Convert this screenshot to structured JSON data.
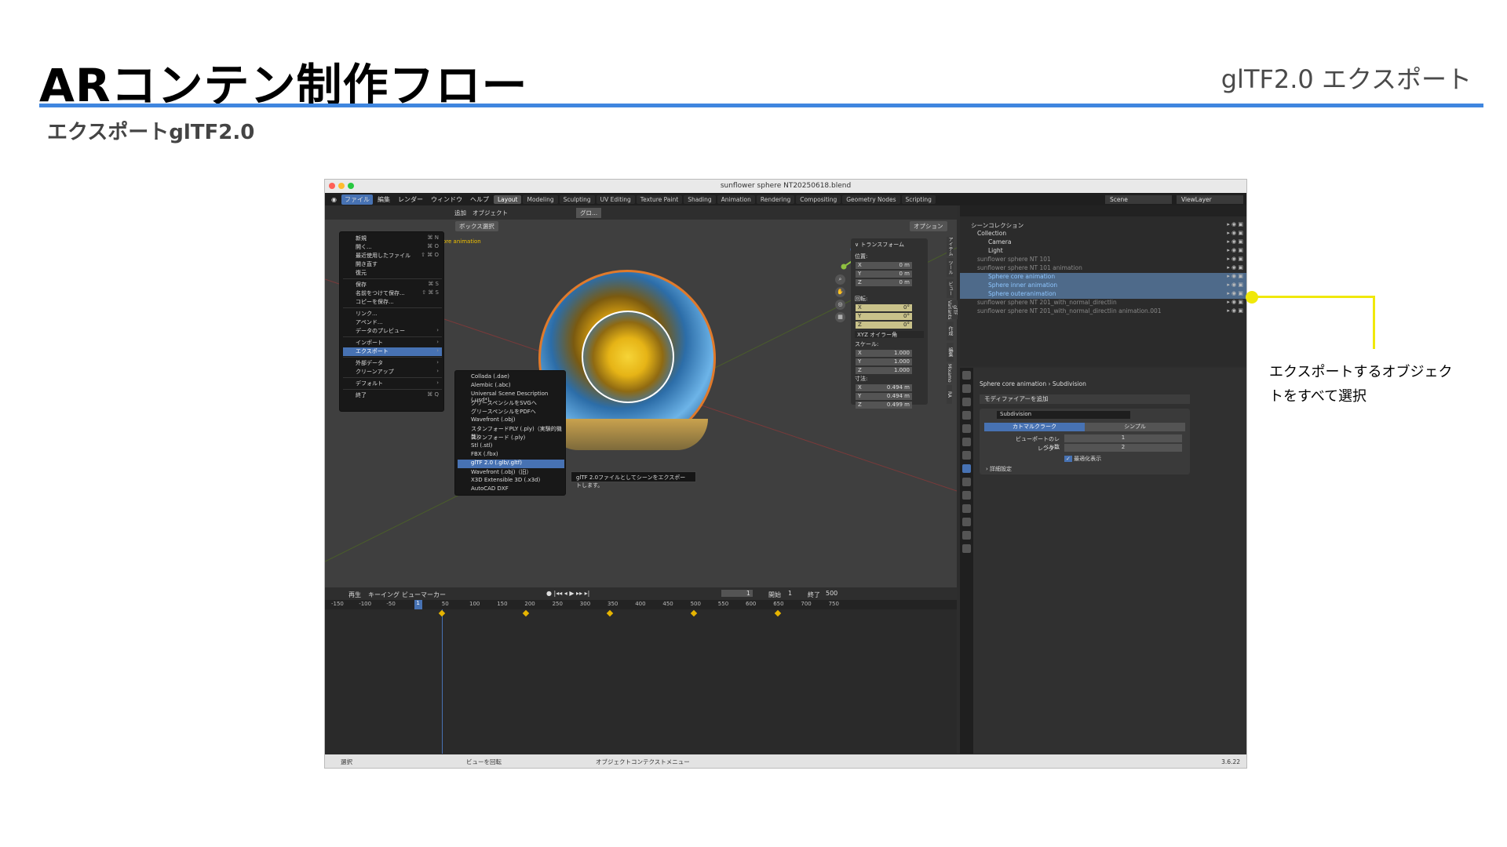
{
  "slide": {
    "title": "ARコンテン制作フロー",
    "topic": "glTF2.0 エクスポート",
    "subtitle": "エクスポートglTF2.0",
    "callout": "エクスポートするオブジェクトをすべて選択"
  },
  "blender": {
    "window_title": "sunflower sphere NT20250618.blend",
    "menus": [
      "ファイル",
      "編集",
      "レンダー",
      "ウィンドウ",
      "ヘルプ"
    ],
    "workspaces": [
      "Layout",
      "Modeling",
      "Sculpting",
      "UV Editing",
      "Texture Paint",
      "Shading",
      "Animation",
      "Rendering",
      "Compositing",
      "Geometry Nodes",
      "Scripting"
    ],
    "scene": "Scene",
    "view_layer": "ViewLayer",
    "vp_buttons": {
      "add": "追加",
      "object": "オブジェクト",
      "global": "グロ...",
      "box_select": "ボックス選択",
      "options": "オプション"
    },
    "viewport_label": "ore animation",
    "file_menu": [
      {
        "label": "新規",
        "shortcut": "⌘ N"
      },
      {
        "label": "開く...",
        "shortcut": "⌘ O"
      },
      {
        "label": "最近使用したファイル",
        "shortcut": "⇧ ⌘ O"
      },
      {
        "label": "開き直す",
        "shortcut": ""
      },
      {
        "label": "復元",
        "shortcut": ""
      },
      {
        "label": "保存",
        "shortcut": "⌘ S"
      },
      {
        "label": "名前をつけて保存...",
        "shortcut": "⇧ ⌘ S"
      },
      {
        "label": "コピーを保存...",
        "shortcut": ""
      },
      {
        "label": "リンク...",
        "shortcut": ""
      },
      {
        "label": "アペンド...",
        "shortcut": ""
      },
      {
        "label": "データのプレビュー",
        "shortcut": ""
      },
      {
        "label": "インポート",
        "shortcut": ""
      },
      {
        "label": "エクスポート",
        "shortcut": ""
      },
      {
        "label": "外部データ",
        "shortcut": ""
      },
      {
        "label": "クリーンアップ",
        "shortcut": ""
      },
      {
        "label": "デフォルト",
        "shortcut": ""
      },
      {
        "label": "終了",
        "shortcut": "⌘ Q"
      }
    ],
    "export_menu": [
      "Collada (.dae)",
      "Alembic (.abc)",
      "Universal Scene Description (.usd*)",
      "グリースペンシルをSVGへ",
      "グリースペンシルをPDFへ",
      "Wavefront (.obj)",
      "スタンフォードPLY (.ply)（実験的機能）",
      "スタンフォード (.ply)",
      "Stl (.stl)",
      "FBX (.fbx)",
      "glTF 2.0 (.glb/.gltf)",
      "Wavefront (.obj)（旧）",
      "X3D Extensible 3D (.x3d)",
      "AutoCAD DXF"
    ],
    "tooltip": "glTF 2.0ファイルとしてシーンをエクスポートします。",
    "transform": {
      "header": "トランスフォーム",
      "location": "位置:",
      "rotation": "回転:",
      "mode": "XYZ オイラー角",
      "scale": "スケール:",
      "dimensions": "寸法:",
      "loc": [
        "0 m",
        "0 m",
        "0 m"
      ],
      "rot": [
        "0°",
        "0°",
        "0°"
      ],
      "scl": [
        "1.000",
        "1.000",
        "1.000"
      ],
      "dim": [
        "0.494 m",
        "0.494 m",
        "0.499 m"
      ]
    },
    "side_tabs": [
      "アイテム",
      "ツール",
      "ビュー",
      "glTF Variants",
      "作成",
      "編集",
      "Mixamo",
      "RA"
    ],
    "timeline": {
      "playback": "再生",
      "keying": "キーイング",
      "view": "ビュー",
      "marker": "マーカー",
      "frame": "1",
      "start_label": "開始",
      "start": "1",
      "end_label": "終了",
      "end": "500",
      "ticks": [
        "-150",
        "-100",
        "-50",
        "1",
        "50",
        "100",
        "150",
        "200",
        "250",
        "300",
        "350",
        "400",
        "450",
        "500",
        "550",
        "600",
        "650",
        "700",
        "750"
      ]
    },
    "statusbar": {
      "select": "選択",
      "rotate": "ビューを回転",
      "context": "オブジェクトコンテクストメニュー",
      "version": "3.6.22"
    },
    "outliner": [
      {
        "label": "シーンコレクション",
        "state": "normal"
      },
      {
        "label": "Collection",
        "state": "normal"
      },
      {
        "label": "Camera",
        "state": "normal"
      },
      {
        "label": "Light",
        "state": "normal"
      },
      {
        "label": "sunflower sphere NT 101",
        "state": "dim"
      },
      {
        "label": "sunflower sphere NT 101 animation",
        "state": "dim"
      },
      {
        "label": "Sphere core animation",
        "state": "sel"
      },
      {
        "label": "Sphere inner animation",
        "state": "sel"
      },
      {
        "label": "Sphere outeranimation",
        "state": "sel"
      },
      {
        "label": "sunflower sphere NT 201_with_normal_directIin",
        "state": "dim"
      },
      {
        "label": "sunflower sphere NT 201_with_normal_directIin animation.001",
        "state": "dim"
      }
    ],
    "properties": {
      "object": "Sphere core animation",
      "modifier": "Subdivision",
      "add_modifier": "モディファイアーを追加",
      "name": "Subdivision",
      "catmull": "カトマルクラーク",
      "simple": "シンプル",
      "viewport_levels_label": "ビューポートのレベル数",
      "viewport_levels": "1",
      "render_label": "レンダー",
      "render_levels": "2",
      "optimal": "最適化表示",
      "advanced": "詳細設定"
    }
  }
}
